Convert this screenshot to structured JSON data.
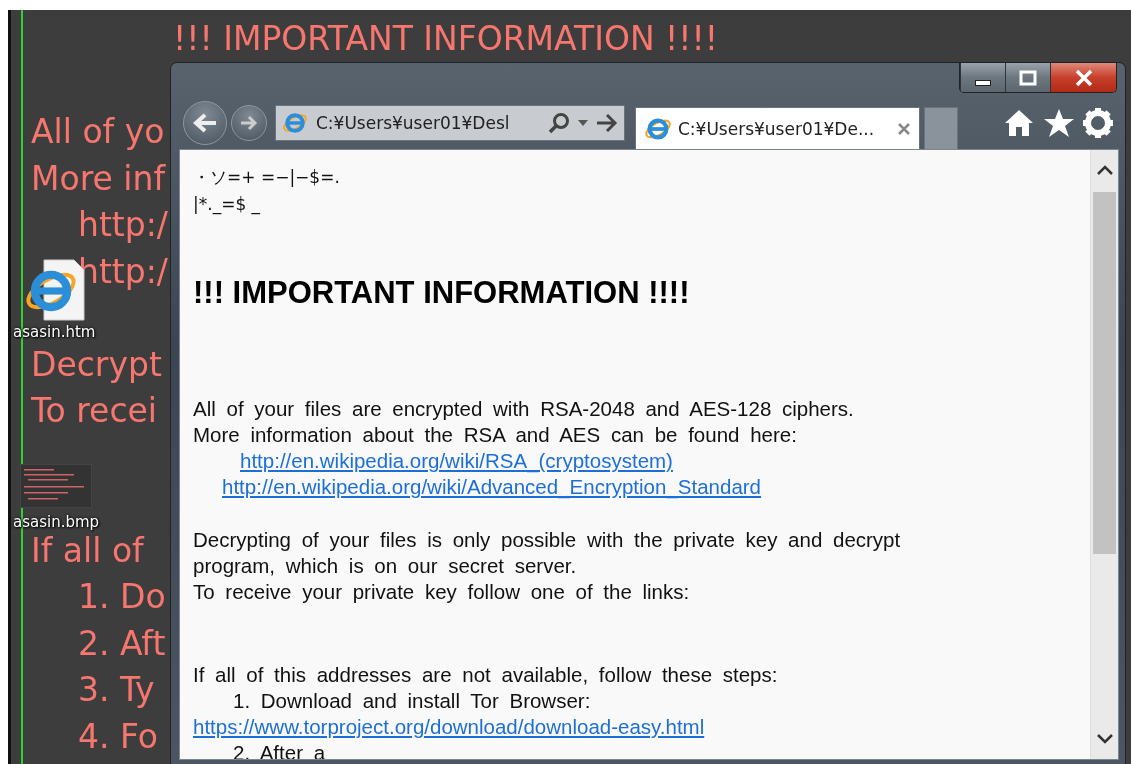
{
  "desktop": {
    "wallpaper_title": "!!! IMPORTANT INFORMATION !!!!",
    "wallpaper_paragraphs": [
      {
        "kind": "paragraph",
        "lines": [
          {
            "kind": "plain",
            "text": "All of yo"
          },
          {
            "kind": "plain",
            "text": "More inf"
          },
          {
            "kind": "indented",
            "text": "http:/"
          },
          {
            "kind": "indented",
            "text": "http:/"
          }
        ]
      },
      {
        "kind": "paragraph",
        "lines": [
          {
            "kind": "plain",
            "text": "Decrypt"
          },
          {
            "kind": "plain",
            "text": "To recei"
          }
        ]
      },
      {
        "kind": "paragraph-wide",
        "lines": [
          {
            "kind": "plain",
            "text": "If all of"
          },
          {
            "kind": "indented",
            "text": "1. Do"
          },
          {
            "kind": "indented",
            "text": "2. Aft"
          },
          {
            "kind": "indented",
            "text": "3. Ty"
          },
          {
            "kind": "indented",
            "text": "4. Fo"
          }
        ]
      }
    ],
    "icons": [
      {
        "kind": "web-page",
        "label": "asasin.htm"
      },
      {
        "kind": "image",
        "label": "asasin.bmp"
      }
    ]
  },
  "browser": {
    "address": "C:¥Users¥user01¥Desl",
    "tabs": [
      {
        "label": "C:¥Users¥user01¥De...",
        "selected": true
      }
    ],
    "page": {
      "garbled": [
        "・ソ=+ =−|−$=.",
        "|*._=$ _"
      ],
      "heading": "!!! IMPORTANT INFORMATION !!!!",
      "paragraphs": [
        {
          "kind": "paragraph",
          "lines": [
            {
              "kind": "text",
              "text": "All of your files are encrypted with RSA-2048 and AES-128 ciphers."
            },
            {
              "kind": "text",
              "text": "More information about the RSA and AES can be found here:"
            },
            {
              "kind": "indented-link",
              "text": "http://en.wikipedia.org/wiki/RSA_(cryptosystem)"
            },
            {
              "kind": "half-indented-link",
              "text": "http://en.wikipedia.org/wiki/Advanced_Encryption_Standard"
            }
          ]
        },
        {
          "kind": "paragraph",
          "lines": [
            {
              "kind": "text",
              "text": "Decrypting of your files is only possible with the private key and decrypt"
            },
            {
              "kind": "text",
              "text": "program, which is on our secret server."
            },
            {
              "kind": "text",
              "text": "To receive your private key follow one of the links:"
            }
          ]
        },
        {
          "kind": "paragraph-wide",
          "lines": [
            {
              "kind": "text",
              "text": "If all of this addresses are not available, follow these steps:"
            },
            {
              "kind": "step",
              "text": "1. Download and install Tor Browser:"
            },
            {
              "kind": "link",
              "text": "https://www.torproject.org/download/download-easy.html"
            },
            {
              "kind": "step",
              "text": "2. After a"
            }
          ]
        }
      ]
    }
  }
}
